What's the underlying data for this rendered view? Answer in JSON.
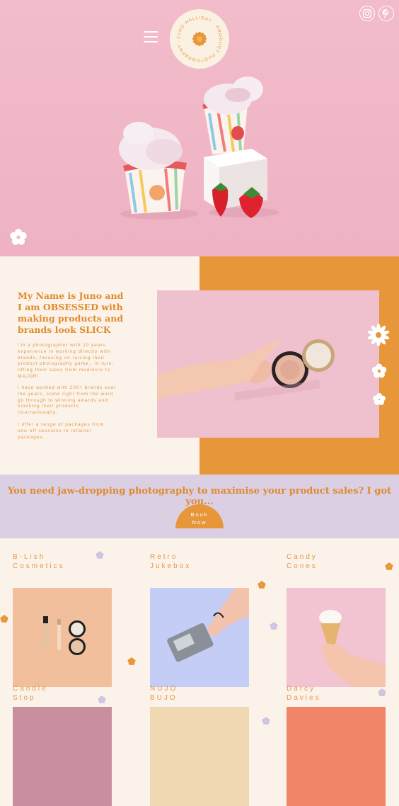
{
  "header": {
    "menu_icon": "hamburger-menu-icon",
    "logo": {
      "ring_text": "JUNO HALLIDAY · PRODUCT PHOTOGRAPHY ·",
      "icon": "flower-logo-icon"
    },
    "social": [
      {
        "name": "instagram",
        "icon": "instagram-icon"
      },
      {
        "name": "pinterest",
        "icon": "pinterest-icon"
      }
    ]
  },
  "about": {
    "heading_lines": [
      "My Name is Juno and",
      "I am OBSESSED with",
      "making products and",
      "brands look SLICK"
    ],
    "paragraphs": [
      [
        "I'm a photographer with 10 years",
        "experience in working directly with",
        "brands, focusing on raising their",
        "product photography game.. in turn,",
        "lifting their sales from mediocre to",
        "MAJOR!"
      ],
      [
        "I have worked with 200+ brands over",
        "the years, some right from the word",
        "go through to winning awards and",
        "stocking their products",
        "internationally."
      ],
      [
        "I offer a range of packages from",
        "one-off sessions to retainer",
        "packages."
      ]
    ]
  },
  "cta": {
    "headline": "You need jaw-dropping  photography to maximise your product sales? I got you...",
    "button_lines": [
      "Book",
      "Now"
    ]
  },
  "portfolio": [
    {
      "lines": [
        "B-Lish",
        "Cosmetics"
      ],
      "bg": "#f1bf9c"
    },
    {
      "lines": [
        "Retro",
        "Jukebox"
      ],
      "bg": "#c4cdf5"
    },
    {
      "lines": [
        "Candy",
        "Cones"
      ],
      "bg": "#f2c3d0"
    },
    {
      "lines": [
        "Candle",
        "Stop"
      ],
      "bg": "#c88f9e"
    },
    {
      "lines": [
        "NUJO",
        "BUJO"
      ],
      "bg": "#efd8b2"
    },
    {
      "lines": [
        "Darcy",
        "Davies"
      ],
      "bg": "#f18568"
    }
  ],
  "colors": {
    "accent": "#e8963a",
    "pink": "#f2bccb",
    "lavender": "#dbcfe4",
    "cream": "#fbf3ea"
  }
}
